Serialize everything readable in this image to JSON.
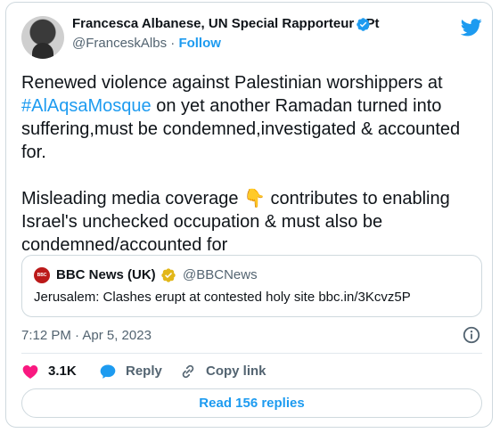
{
  "author": {
    "name": "Francesca Albanese, UN Special Rapporteur oPt",
    "handle": "@FranceskAlbs",
    "separator": "·",
    "follow_label": "Follow"
  },
  "tweet": {
    "line1_a": "Renewed violence against Palestinian worshippers at",
    "hashtag": "#AlAqsaMosque",
    "line2_rest": " on yet another Ramadan turned into",
    "line3": "suffering,must be condemned,investigated & accounted",
    "line4": "for.",
    "p2_a": "Misleading media coverage ",
    "emoji": "👇",
    "p2_b": " contributes to enabling",
    "p2_line2": "Israel's unchecked occupation & must also be",
    "p2_line3": "condemned/accounted for"
  },
  "quote": {
    "logo_text": "BBC NEWS",
    "name": "BBC News (UK)",
    "handle": "@BBCNews",
    "text": "Jerusalem: Clashes erupt at contested holy site bbc.in/3Kcvz5P"
  },
  "timestamp": "7:12 PM · Apr 5, 2023",
  "actions": {
    "likes": "3.1K",
    "reply_label": "Reply",
    "copy_label": "Copy link"
  },
  "read_replies_label": "Read 156 replies",
  "colors": {
    "accent": "#1d9bf0",
    "like": "#f91880",
    "muted": "#536471",
    "gold_badge": "#e2b719",
    "bbc_red": "#bb1919"
  }
}
